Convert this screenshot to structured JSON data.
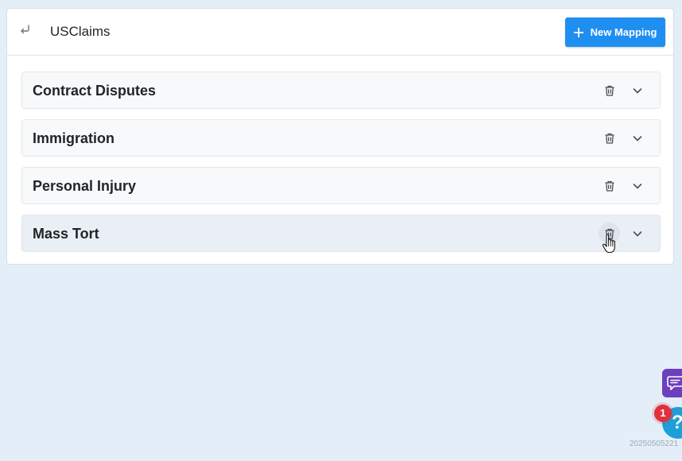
{
  "header": {
    "title": "USClaims",
    "back_icon": "return-arrow-icon",
    "new_button_label": "New Mapping",
    "new_button_icon": "plus-icon",
    "accent_color": "#1f8ef1"
  },
  "mappings": [
    {
      "label": "Contract Disputes",
      "delete_icon": "trash-icon",
      "expand_icon": "chevron-down-icon"
    },
    {
      "label": "Immigration",
      "delete_icon": "trash-icon",
      "expand_icon": "chevron-down-icon"
    },
    {
      "label": "Personal Injury",
      "delete_icon": "trash-icon",
      "expand_icon": "chevron-down-icon"
    },
    {
      "label": "Mass Tort",
      "delete_icon": "trash-icon",
      "expand_icon": "chevron-down-icon"
    }
  ],
  "widgets": {
    "chat_icon": "chat-icon",
    "help_icon": "help-icon",
    "help_glyph": "?",
    "notification_count": "1",
    "chat_color": "#6d3fbf",
    "help_color": "#1da0d8",
    "badge_color": "#e0303b"
  },
  "footer": {
    "version": "20250505221"
  }
}
